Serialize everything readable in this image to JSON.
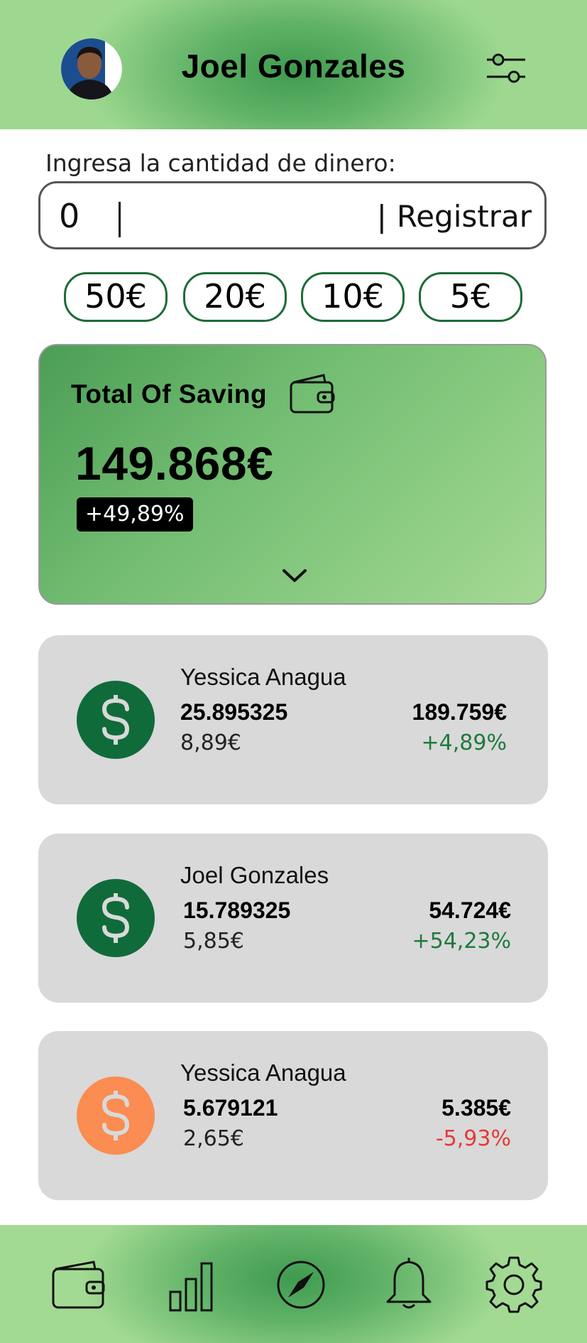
{
  "header": {
    "user_name": "Joel Gonzales"
  },
  "amount_form": {
    "label": "Ingresa la cantidad de dinero:",
    "value": "0",
    "separator": "|",
    "register_label": "Registrar"
  },
  "quick_amounts": [
    "50€",
    "20€",
    "10€",
    "5€"
  ],
  "saving_card": {
    "title": "Total Of Saving",
    "amount": "149.868€",
    "change": "+49,89%"
  },
  "holdings": [
    {
      "name": "Yessica Anagua",
      "units": "25.895325",
      "price": "8,89€",
      "total": "189.759€",
      "change": "+4,89%",
      "change_color": "#1f7a3c",
      "coin_color": "#106b3a"
    },
    {
      "name": "Joel Gonzales",
      "units": "15.789325",
      "price": "5,85€",
      "total": "54.724€",
      "change": "+54,23%",
      "change_color": "#1f7a3c",
      "coin_color": "#106b3a"
    },
    {
      "name": "Yessica Anagua",
      "units": "5.679121",
      "price": "2,65€",
      "total": "5.385€",
      "change": "-5,93%",
      "change_color": "#e53935",
      "coin_color": "#fb8c52"
    }
  ],
  "nav": {
    "items": [
      "wallet-icon",
      "bar-chart-icon",
      "compass-icon",
      "bell-icon",
      "gear-icon"
    ]
  },
  "colors": {
    "accent_green": "#4c9d55",
    "coin_green": "#106b3a",
    "coin_orange": "#fb8c52",
    "positive": "#1f7a3c",
    "negative": "#e53935",
    "card_gray": "#d9d9d9"
  }
}
